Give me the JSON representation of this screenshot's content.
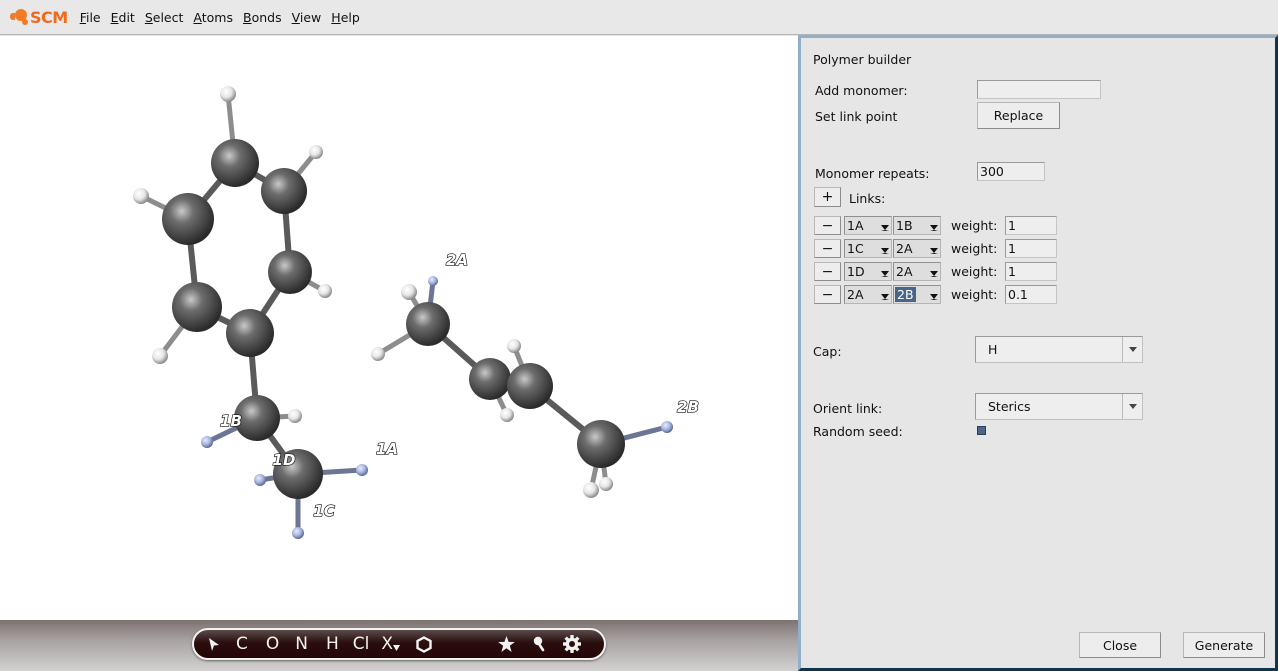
{
  "app": {
    "logo_text": "SCM",
    "brand_color": "#ef6a1d"
  },
  "menu": [
    {
      "label": "File",
      "mnemonic": "F"
    },
    {
      "label": "Edit",
      "mnemonic": "E"
    },
    {
      "label": "Select",
      "mnemonic": "S"
    },
    {
      "label": "Atoms",
      "mnemonic": "A"
    },
    {
      "label": "Bonds",
      "mnemonic": "B"
    },
    {
      "label": "View",
      "mnemonic": "V"
    },
    {
      "label": "Help",
      "mnemonic": "H"
    }
  ],
  "viewport": {
    "labels": [
      "1A",
      "1B",
      "1C",
      "1D",
      "2A",
      "2B"
    ],
    "colors": {
      "carbon": "#555555",
      "hydrogen": "#f0f0f0",
      "link_atom": "#9aaad8",
      "link_bond": "#6c7592"
    }
  },
  "toolbar": {
    "items": [
      {
        "name": "select-arrow",
        "label": "➤"
      },
      {
        "name": "element-c",
        "label": "C"
      },
      {
        "name": "element-o",
        "label": "O"
      },
      {
        "name": "element-n",
        "label": "N"
      },
      {
        "name": "element-h",
        "label": "H"
      },
      {
        "name": "element-cl",
        "label": "Cl"
      },
      {
        "name": "element-x",
        "label": "X"
      },
      {
        "name": "ring",
        "label": "⬡"
      },
      {
        "name": "favorites-star",
        "label": "★"
      },
      {
        "name": "search-key",
        "label": "⚲"
      },
      {
        "name": "settings-gear",
        "label": "⚙"
      }
    ]
  },
  "panel": {
    "title": "Polymer builder",
    "add_monomer_label": "Add monomer:",
    "add_monomer_value": "",
    "set_link_point_label": "Set link point",
    "replace_button": "Replace",
    "monomer_repeats_label": "Monomer repeats:",
    "monomer_repeats_value": "300",
    "add_link_button": "+",
    "links_label": "Links:",
    "remove_button": "−",
    "weight_label": "weight:",
    "links": [
      {
        "from": "1A",
        "to": "1B",
        "weight": "1",
        "to_selected": false
      },
      {
        "from": "1C",
        "to": "2A",
        "weight": "1",
        "to_selected": false
      },
      {
        "from": "1D",
        "to": "2A",
        "weight": "1",
        "to_selected": false
      },
      {
        "from": "2A",
        "to": "2B",
        "weight": "0.1",
        "to_selected": true
      }
    ],
    "cap_label": "Cap:",
    "cap_value": "H",
    "orient_link_label": "Orient link:",
    "orient_link_value": "Sterics",
    "random_seed_label": "Random seed:",
    "random_seed_checked": true,
    "close_button": "Close",
    "generate_button": "Generate"
  }
}
